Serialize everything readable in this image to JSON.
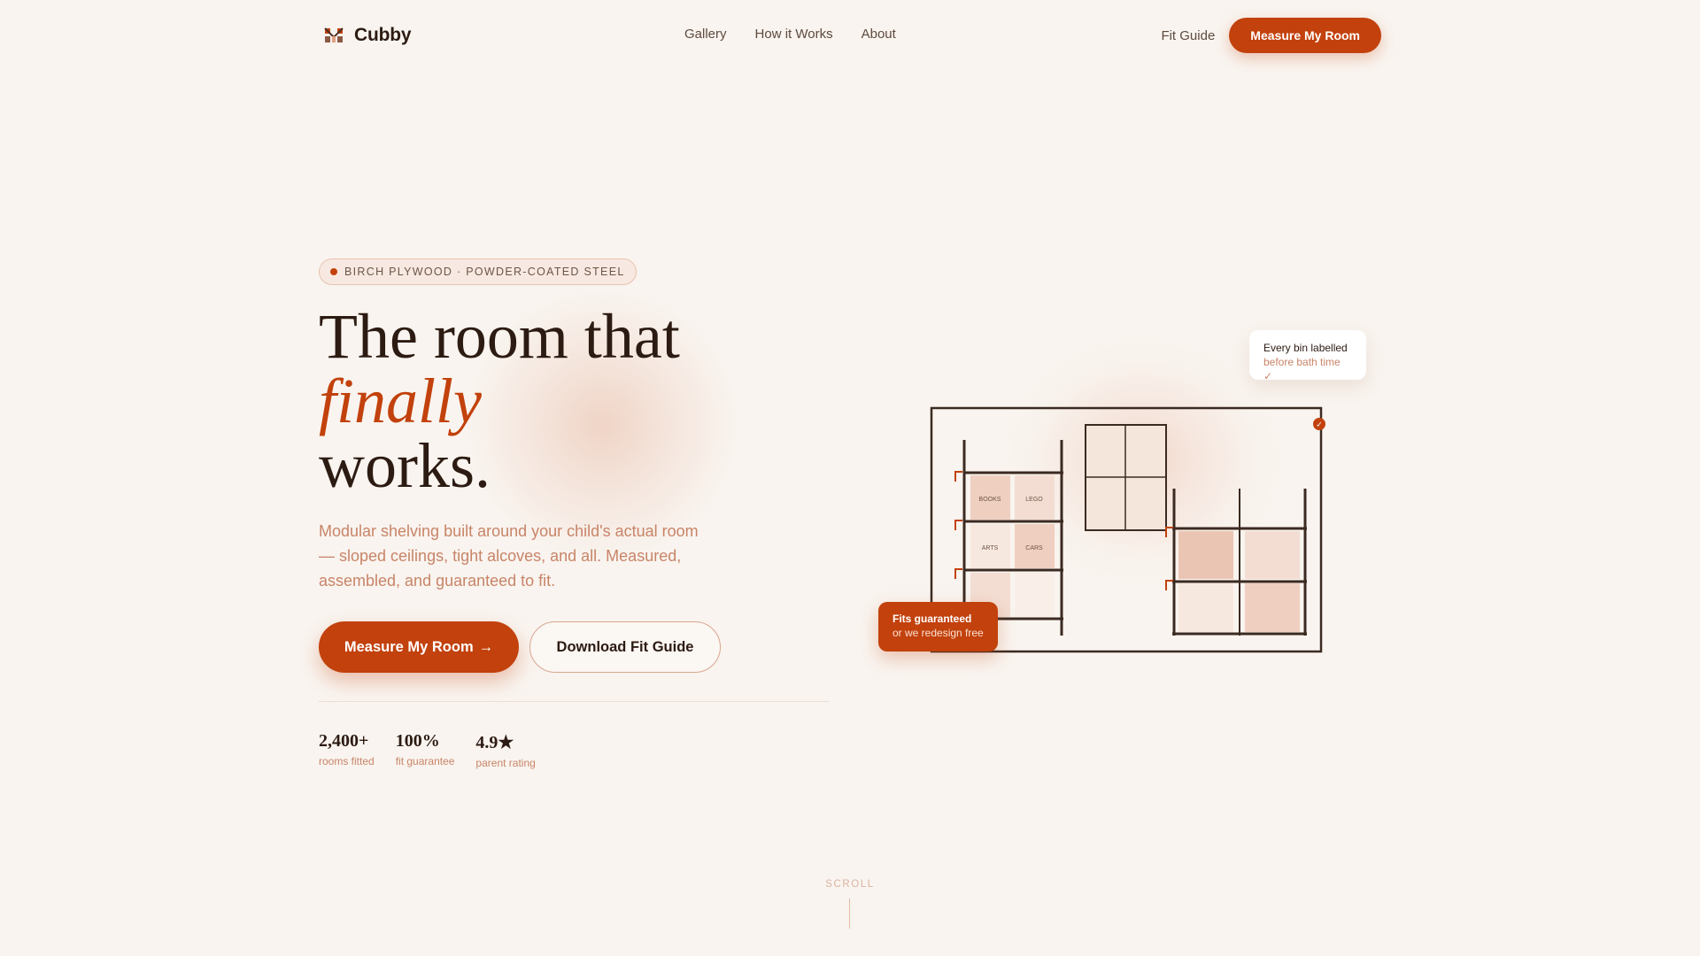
{
  "nav": {
    "brand": "Cubby",
    "links": [
      "Gallery",
      "How it Works",
      "About"
    ],
    "fit_guide": "Fit Guide",
    "cta": "Measure My Room"
  },
  "hero": {
    "badge": "BIRCH PLYWOOD · POWDER-COATED STEEL",
    "headline_line1": "The room that",
    "headline_accent": "finally",
    "headline_line3": "works.",
    "subtext": "Modular shelving built around your child's actual room — sloped ceilings, tight alcoves, and all. Measured, assembled, and guaranteed to fit.",
    "primary_cta": "Measure My Room",
    "primary_cta_arrow": "→",
    "secondary_cta": "Download Fit Guide",
    "stats": [
      {
        "value": "2,400+",
        "label": "rooms fitted"
      },
      {
        "value": "100%",
        "label": "fit guarantee"
      },
      {
        "value": "4.9★",
        "label": "parent rating"
      }
    ]
  },
  "illustration": {
    "bin_labels": [
      "BOOKS",
      "LEGO",
      "ARTS",
      "CARS"
    ],
    "card_labelled": {
      "line1": "Every bin labelled",
      "line2": "before bath time ✓"
    },
    "card_guarantee": {
      "line1": "Fits guaranteed",
      "line2": "or we redesign free"
    },
    "check_glyph": "✓"
  },
  "scroll_label": "SCROLL",
  "colors": {
    "accent": "#c2410c",
    "background": "#f9f4ef",
    "text": "#2c1b12",
    "muted": "#c88468"
  }
}
